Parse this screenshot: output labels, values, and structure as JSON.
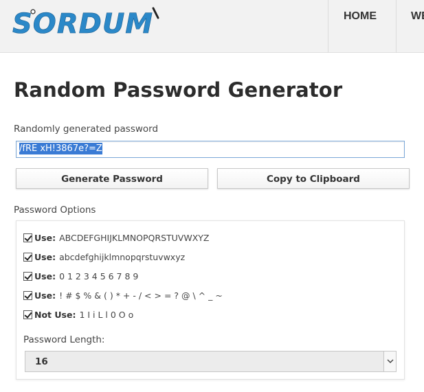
{
  "brand": {
    "logo_text": "Sordum",
    "accent": "#2b88c8",
    "dark": "#222222"
  },
  "nav": {
    "items": [
      {
        "label": "HOME"
      },
      {
        "label": "WE"
      }
    ]
  },
  "page": {
    "title": "Random Password Generator",
    "password_label": "Randomly generated password",
    "password_value": "/fRE xH!3867e?=Z"
  },
  "buttons": {
    "generate": "Generate Password",
    "copy": "Copy to Clipboard"
  },
  "options": {
    "section_label": "Password Options",
    "items": [
      {
        "key": "Use:",
        "chars": "ABCDEFGHIJKLMNOPQRSTUVWXYZ",
        "checked": true
      },
      {
        "key": "Use:",
        "chars": "abcdefghijklmnopqrstuvwxyz",
        "checked": true
      },
      {
        "key": "Use:",
        "chars": "0 1 2 3 4 5 6 7 8 9",
        "checked": true
      },
      {
        "key": "Use:",
        "chars": "! # $ % & ( ) * + - / < > = ? @ \\ ^ _ ~",
        "checked": true
      },
      {
        "key": "Not Use:",
        "chars": "1 I i L l 0 O o",
        "checked": true
      }
    ],
    "length_label": "Password Length:",
    "length_value": "16"
  }
}
